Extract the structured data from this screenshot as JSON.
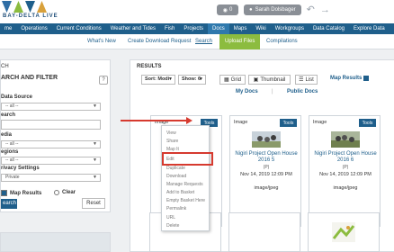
{
  "header": {
    "logo_text": "BAY-DELTA LIVE",
    "logo_colors": [
      "#2f6ea5",
      "#8cbc3f",
      "#1f5f8b",
      "#d9a13b"
    ],
    "badge_count": "0",
    "user_name": "Sarah Dolsbager"
  },
  "nav": {
    "items": [
      "me",
      "Operations",
      "Current Conditions",
      "Weather and Tides",
      "Fish",
      "Projects",
      "Docs",
      "Maps",
      "Wiki",
      "Workgroups",
      "Data Catalog",
      "Explore Data"
    ],
    "active_index": 6
  },
  "subnav": {
    "whats_new": "What's New",
    "create_request": "Create Download Request",
    "search": "Search",
    "upload": "Upload Files",
    "compilations": "Compilations"
  },
  "left_panel": {
    "title": "CH",
    "heading": "ARCH AND FILTER",
    "help": "?",
    "labels": {
      "data_source": "Data Source",
      "search": "earch",
      "media": "edia",
      "regions": "egions",
      "privacy": "rivacy Settings"
    },
    "placeholders": {
      "data_source": "-- all --",
      "media": "-- all --",
      "regions": "-- all --",
      "privacy": "Private"
    },
    "map_results": "Map Results",
    "clear": "Clear",
    "search_button": "earch",
    "reset_button": "Reset"
  },
  "results": {
    "title": "RESULTS",
    "sort_label": "Sort: Modi",
    "show_label": "Show: 6",
    "grid": "Grid",
    "thumbnail": "Thumbnail",
    "list": "List",
    "map_results": "Map Results",
    "my_docs": "My Docs",
    "public_docs": "Public Docs",
    "cards": [
      {
        "type": "Image",
        "tools": "Tools",
        "title": "",
        "part": "",
        "date": "",
        "format": ""
      },
      {
        "type": "Image",
        "tools": "Tools",
        "title": "Nigiri Project Open House 2016 5",
        "part": "(P)",
        "date": "Nov 14, 2019 12:09 PM",
        "format": "image/jpeg"
      },
      {
        "type": "Image",
        "tools": "Tools",
        "title": "Nigiri Project Open House 2016 6",
        "part": "(P)",
        "date": "Nov 14, 2019 12:09 PM",
        "format": "image/jpeg"
      }
    ]
  },
  "tools_menu": {
    "items": [
      "View",
      "Share",
      "Map It",
      "Edit",
      "Duplicate",
      "Download",
      "Manage Requests",
      "Add to Basket",
      "Empty Basket Here",
      "Permalink",
      "URL",
      "Delete"
    ],
    "highlighted_index": 3
  },
  "icons": {
    "badge": "camera-icon",
    "user": "user-icon",
    "back": "back-arrow-icon",
    "forward": "forward-arrow-icon",
    "help": "question-icon",
    "grid": "grid-icon",
    "thumbnail": "thumbnail-icon",
    "list": "list-icon",
    "add": "plus-icon",
    "share": "users-icon"
  },
  "colors": {
    "nav": "#1f5f8b",
    "upload": "#8cbc3f",
    "annotation": "#d63a2f"
  }
}
